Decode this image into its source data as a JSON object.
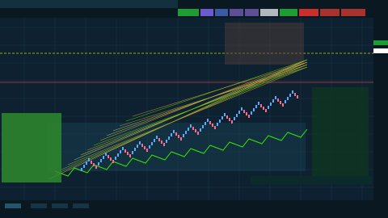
{
  "window": {
    "tab_label": "",
    "symbol_readout": ""
  },
  "toolbar": {
    "buttons": [
      {
        "label": "",
        "color": "#1e9c36"
      },
      {
        "label": "",
        "color": "#6a5ccf"
      },
      {
        "label": "",
        "color": "#3b5aa3"
      },
      {
        "label": "",
        "color": "#5c4f96"
      },
      {
        "label": "",
        "color": "#5c4f96"
      },
      {
        "label": "",
        "color": "#b0b8bd"
      },
      {
        "label": "",
        "color": "#1e9c36"
      },
      {
        "label": "",
        "color": "#c9302c"
      },
      {
        "label": "",
        "color": "#a8322d"
      },
      {
        "label": "",
        "color": "#a8322d"
      }
    ]
  },
  "chart": {
    "header_text": "",
    "colors": {
      "up": "#5aa9ff",
      "down": "#ff6a8a",
      "trend": "#39e600",
      "reference": "#d4d400",
      "marker": "#d23a3a"
    }
  },
  "y_axis": {
    "price_tag": "",
    "price_tag_color": "#1e9c36",
    "current_tag": "",
    "current_tag_color": "#ffffff"
  },
  "stats_panel": {
    "header": "",
    "lines": []
  },
  "overlay": {
    "title": "",
    "lines": []
  },
  "status_line": "",
  "bottom_tabs": [
    {
      "label": ""
    },
    {
      "label": ""
    },
    {
      "label": ""
    },
    {
      "label": ""
    }
  ]
}
